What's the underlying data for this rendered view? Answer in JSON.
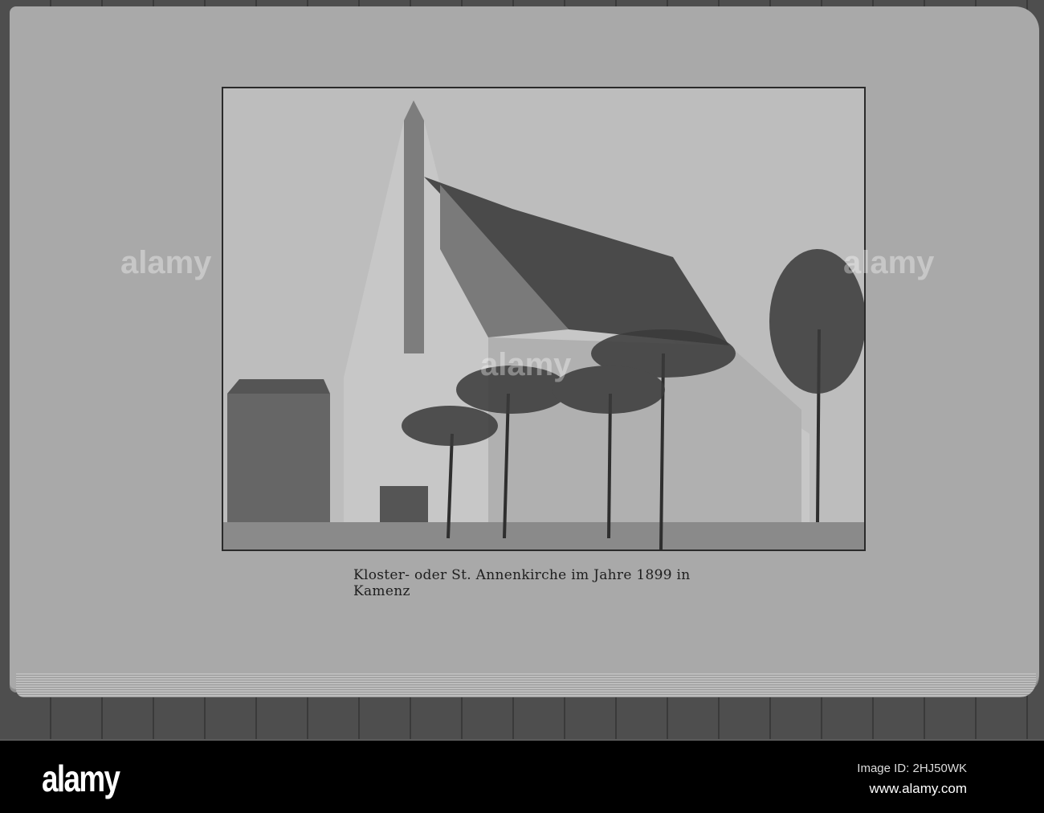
{
  "caption": "Kloster- oder St. Annenkirche im Jahre 1899 in Kamenz",
  "footer": {
    "logo": "alamy",
    "image_id": "Image ID: 2HJ50WK",
    "url": "www.alamy.com"
  }
}
